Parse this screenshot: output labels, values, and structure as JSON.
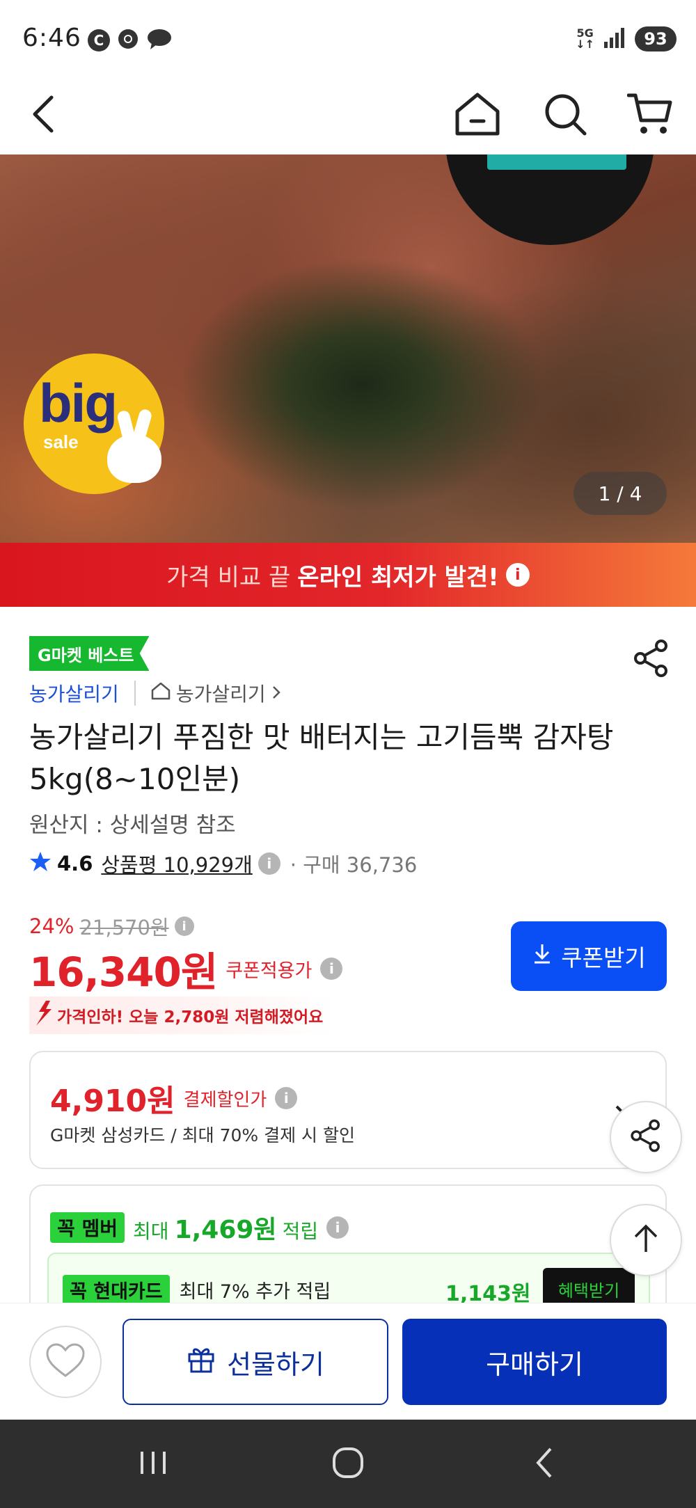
{
  "status_bar": {
    "time": "6:46",
    "left_icons": [
      "C",
      "chrome-icon",
      "chat-icon"
    ],
    "network_top": "5G",
    "battery": "93"
  },
  "nav": {
    "back_icon": "back-arrow-icon",
    "home_icon": "home-icon",
    "search_icon": "search-icon",
    "cart_icon": "cart-icon"
  },
  "hero": {
    "badge_big": "big",
    "badge_sale": "sale",
    "page_indicator": "1 / 4"
  },
  "price_banner": {
    "light_text": "가격 비교 끝",
    "bold_text": "온라인 최저가 발견!",
    "info": "i"
  },
  "product": {
    "best_badge": "G마켓 베스트",
    "seller": "농가살리기",
    "store": "농가살리기",
    "title": "농가살리기 푸짐한 맛 배터지는 고기듬뿍 감자탕 5kg(8~10인분)",
    "origin": "원산지 : 상세설명 참조",
    "rating": "4.6",
    "review_label": "상품평 10,929개",
    "purchase": "· 구매 36,736",
    "discount_rate": "24%",
    "original_price": "21,570원",
    "price": "16,340원",
    "price_label": "쿠폰적용가",
    "coupon_button": "쿠폰받기",
    "price_drop": "가격인하! 오늘 2,780원 저렴해졌어요"
  },
  "payment": {
    "amount": "4,910원",
    "label": "결제할인가",
    "description": "G마켓 삼성카드 / 최대 70% 결제 시 할인"
  },
  "membership": {
    "badge": "꼭 멤버",
    "prefix": "최대",
    "amount": "1,469원",
    "suffix": "적립",
    "card_badge": "꼭 현대카드",
    "card_text": "최대 7% 추가 적립",
    "card_amount": "1,143원",
    "card_button": "혜택받기"
  },
  "bottom_bar": {
    "gift_label": "선물하기",
    "buy_label": "구매하기"
  },
  "colors": {
    "accent_red": "#e0222a",
    "accent_blue": "#0a4ff5",
    "buy_blue": "#0730b8",
    "green": "#2bd13a"
  }
}
